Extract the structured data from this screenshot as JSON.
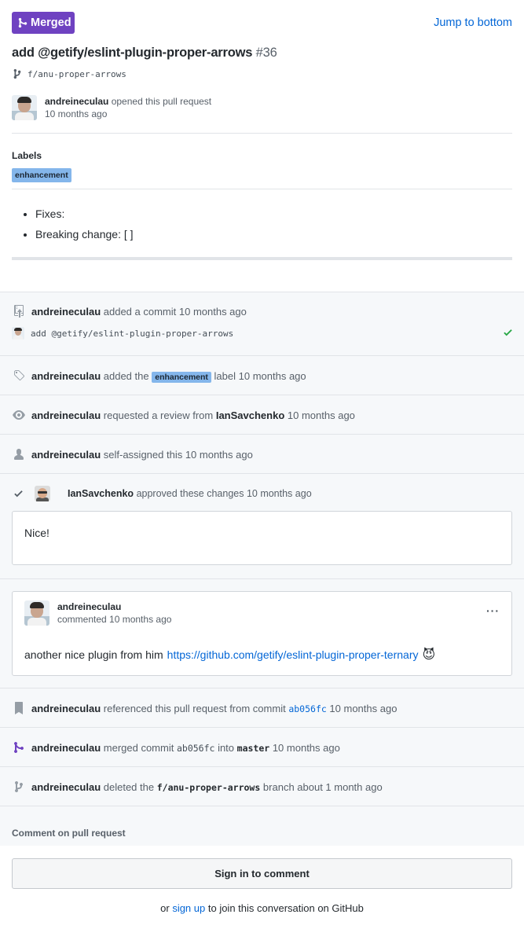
{
  "header": {
    "status": "Merged",
    "jump": "Jump to bottom",
    "title": "add @getify/eslint-plugin-proper-arrows",
    "number": "#36",
    "branch": "f/anu-proper-arrows",
    "author": "andreineculau",
    "opened_text": "opened this pull request",
    "opened_time": "10 months ago",
    "purple": "#6f42c1"
  },
  "labels": {
    "heading": "Labels",
    "items": [
      "enhancement"
    ],
    "label_color": "#84b6eb"
  },
  "body": {
    "items": [
      "Fixes:",
      "Breaking change: [ ]"
    ]
  },
  "timeline": {
    "commit": {
      "user": "andreineculau",
      "action": "added a commit 10 months ago",
      "message": "add @getify/eslint-plugin-proper-arrows",
      "status_icon": "check-icon"
    },
    "label_event": {
      "user": "andreineculau",
      "pre": "added the",
      "label": "enhancement",
      "post": "label 10 months ago"
    },
    "review_request": {
      "user": "andreineculau",
      "pre": "requested a review from",
      "reviewer": "IanSavchenko",
      "post": "10 months ago"
    },
    "assign": {
      "user": "andreineculau",
      "text": "self-assigned this 10 months ago"
    },
    "approval": {
      "user": "IanSavchenko",
      "text": "approved these changes 10 months ago",
      "comment": "Nice!"
    },
    "comment": {
      "user": "andreineculau",
      "meta": "commented 10 months ago",
      "more": "···",
      "text": "another nice plugin from him",
      "link": "https://github.com/getify/eslint-plugin-proper-ternary",
      "emoji": "😈"
    },
    "reference": {
      "user": "andreineculau",
      "pre": "referenced this pull request from commit",
      "sha": "ab056fc",
      "post": "10 months ago"
    },
    "merge": {
      "user": "andreineculau",
      "pre": "merged commit",
      "sha": "ab056fc",
      "mid": "into",
      "target": "master",
      "post": "10 months ago"
    },
    "delete": {
      "user": "andreineculau",
      "pre": "deleted the",
      "branch": "f/anu-proper-arrows",
      "post": "branch about 1 month ago"
    }
  },
  "footer": {
    "heading": "Comment on pull request",
    "signin": "Sign in to comment",
    "or": "or",
    "signup": "sign up",
    "rest": "to join this conversation on GitHub"
  }
}
